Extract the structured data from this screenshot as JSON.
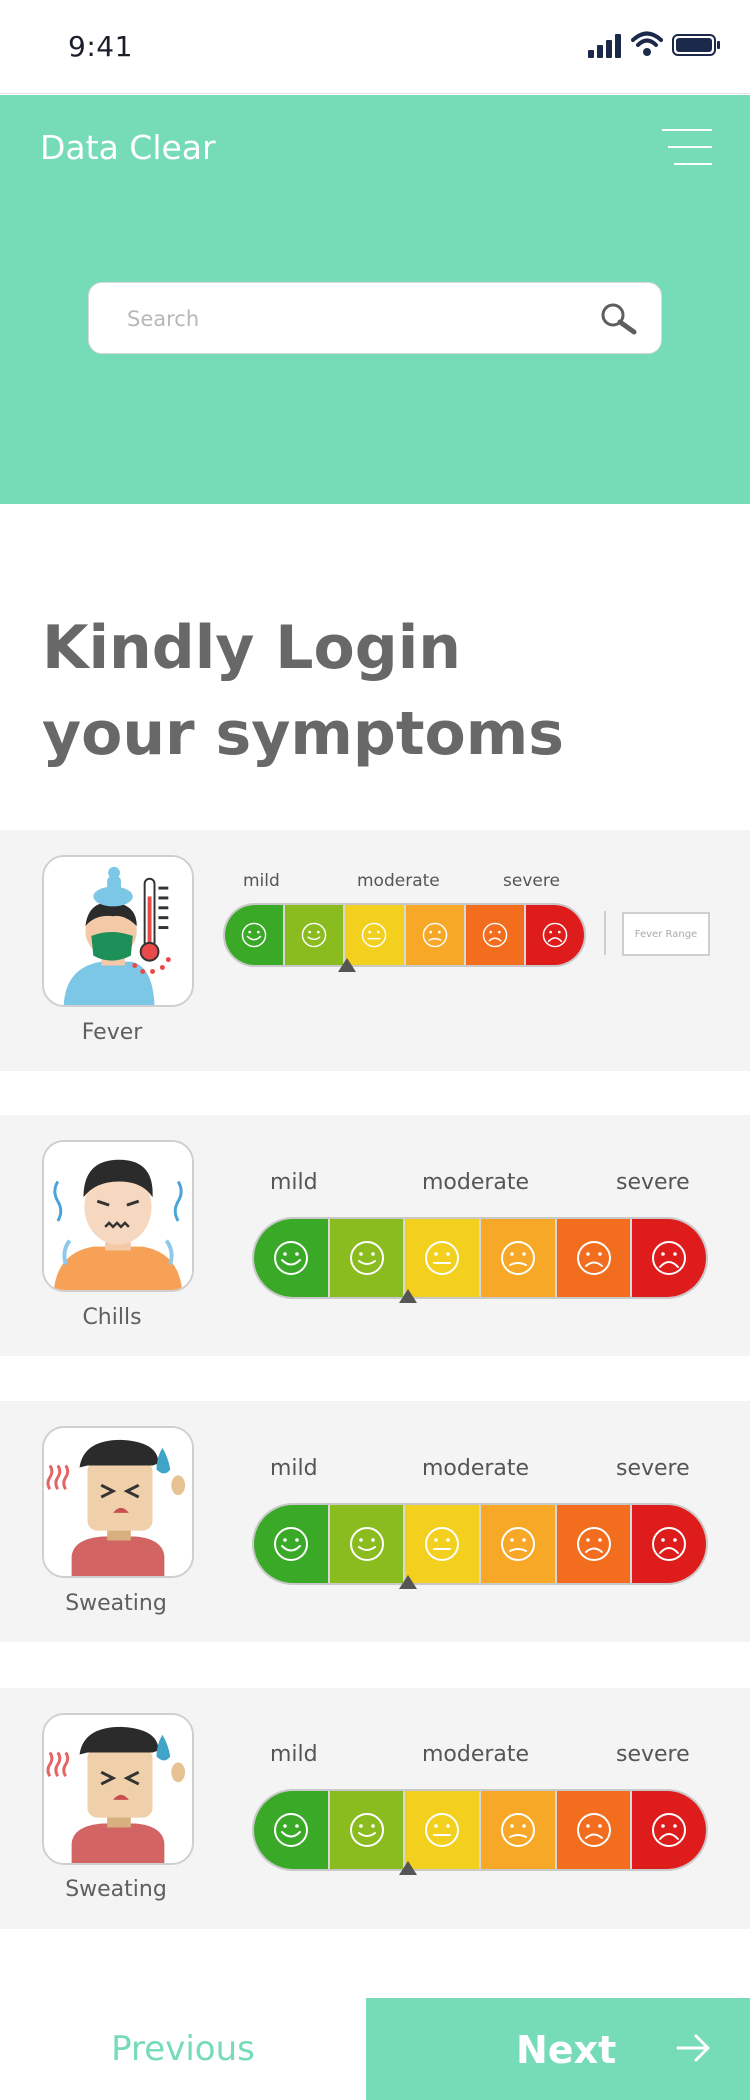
{
  "status_bar": {
    "time": "9:41"
  },
  "header": {
    "app_title": "Data Clear",
    "search": {
      "placeholder": "Search",
      "value": ""
    },
    "menu_icon": "hamburger-icon",
    "search_icon": "search-icon"
  },
  "page": {
    "title_line1": "Kindly Login",
    "title_line2": "your symptoms"
  },
  "scale_levels": {
    "mild": "mild",
    "moderate": "moderate",
    "severe": "severe"
  },
  "scale_colors": [
    "#3aa928",
    "#8bbc1f",
    "#f3d01e",
    "#f8a827",
    "#f26d1e",
    "#de1c1c"
  ],
  "symptoms": [
    {
      "name": "Fever",
      "selected_level": 3,
      "extra_button": "Fever Range"
    },
    {
      "name": "Chills",
      "selected_level": 3
    },
    {
      "name": "Sweating",
      "selected_level": 3
    },
    {
      "name": "Sweating",
      "selected_level": 3
    }
  ],
  "footer": {
    "previous_label": "Previous",
    "next_label": "Next"
  }
}
